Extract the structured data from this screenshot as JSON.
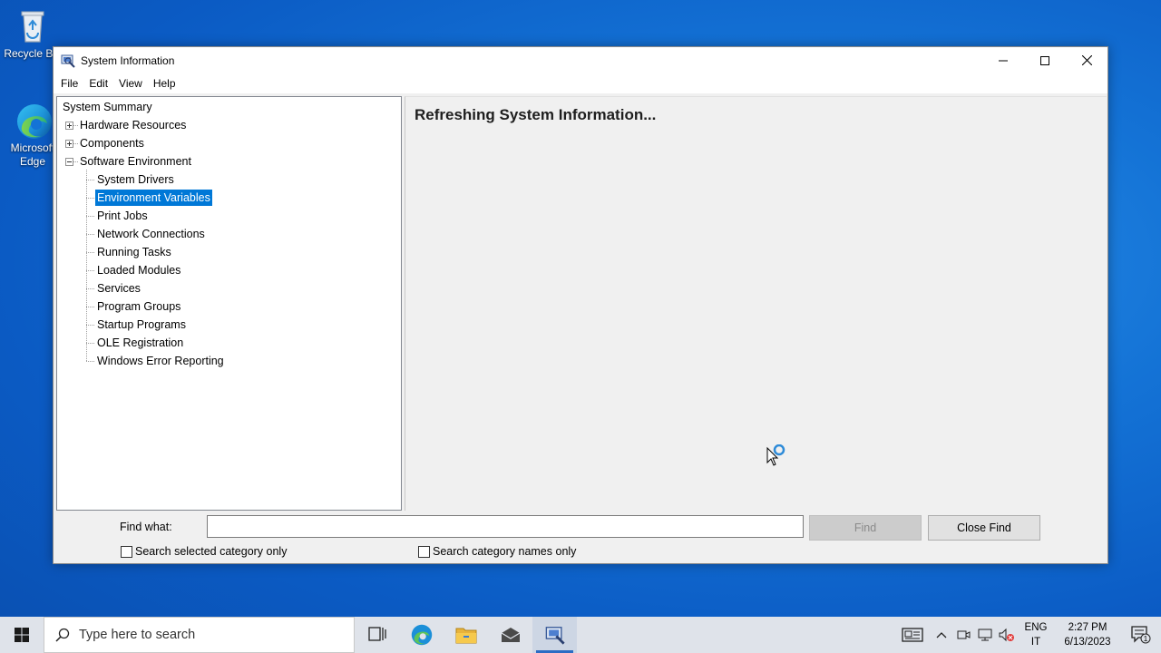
{
  "desktop": {
    "icons": [
      {
        "label": "Recycle Bin"
      },
      {
        "label": "Microsoft Edge"
      }
    ]
  },
  "window": {
    "title": "System Information",
    "menu": [
      "File",
      "Edit",
      "View",
      "Help"
    ]
  },
  "tree": {
    "root": "System Summary",
    "items": [
      {
        "label": "Hardware Resources",
        "expander": "+"
      },
      {
        "label": "Components",
        "expander": "+"
      },
      {
        "label": "Software Environment",
        "expander": "-"
      }
    ],
    "children": [
      "System Drivers",
      "Environment Variables",
      "Print Jobs",
      "Network Connections",
      "Running Tasks",
      "Loaded Modules",
      "Services",
      "Program Groups",
      "Startup Programs",
      "OLE Registration",
      "Windows Error Reporting"
    ],
    "selected": "Environment Variables"
  },
  "content": {
    "status": "Refreshing System Information..."
  },
  "find": {
    "label": "Find what:",
    "value": "",
    "find_button": "Find",
    "close_button": "Close Find",
    "check_selected": "Search selected category only",
    "check_names": "Search category names only"
  },
  "taskbar": {
    "search_placeholder": "Type here to search",
    "lang_top": "ENG",
    "lang_bottom": "IT",
    "time": "2:27 PM",
    "date": "6/13/2023",
    "notification_count": "1"
  },
  "colors": {
    "selection": "#0078d7",
    "desktop": "#1473d6"
  }
}
